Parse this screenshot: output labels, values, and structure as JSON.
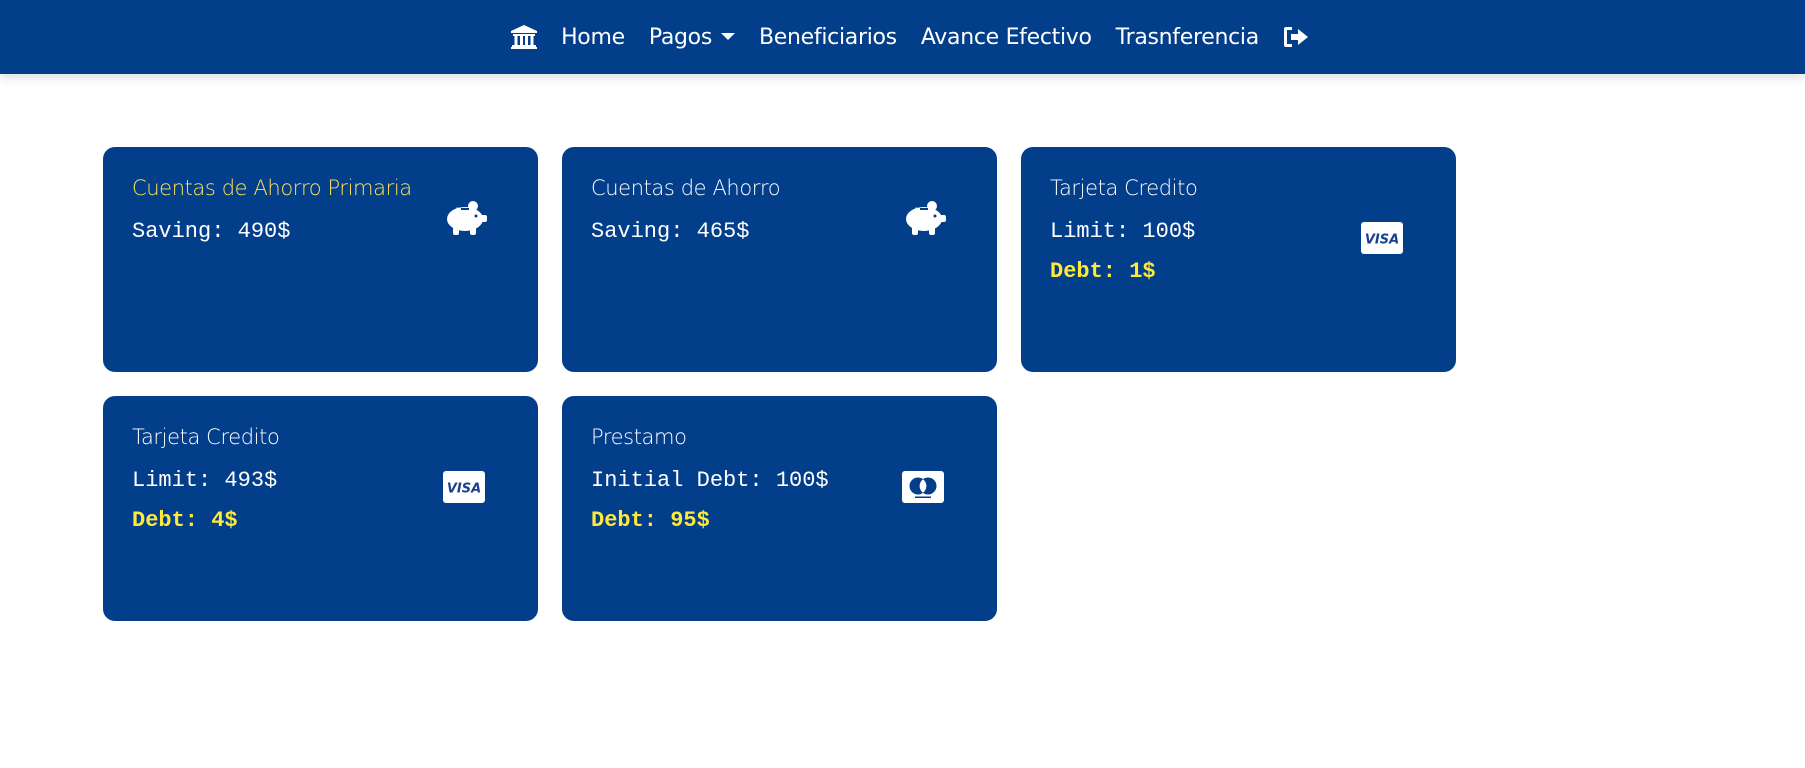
{
  "nav": {
    "items": [
      {
        "label": "Home"
      },
      {
        "label": "Pagos"
      },
      {
        "label": "Beneficiarios"
      },
      {
        "label": "Avance Efectivo"
      },
      {
        "label": "Trasnferencia"
      }
    ],
    "bank_icon": "bank-icon",
    "logout_icon": "sign-out-icon"
  },
  "cards": [
    {
      "title": "Cuentas de Ahorro Primaria",
      "line1": "Saving: 490$",
      "icon": "piggy-bank-icon"
    },
    {
      "title": "Cuentas de Ahorro",
      "line1": "Saving: 465$",
      "icon": "piggy-bank-icon"
    },
    {
      "title": "Tarjeta Credito",
      "line1": "Limit: 100$",
      "line2": "Debt: 1$",
      "icon": "visa-icon"
    },
    {
      "title": "Tarjeta Credito",
      "line1": "Limit: 493$",
      "line2": "Debt: 4$",
      "icon": "visa-icon"
    },
    {
      "title": "Prestamo",
      "line1": "Initial Debt: 100$",
      "line2": "Debt: 95$",
      "icon": "mastercard-icon"
    }
  ],
  "colors": {
    "brand_blue": "#033e8a",
    "highlight_yellow": "#ffea3a",
    "primary_title_yellow": "#ffe156"
  }
}
